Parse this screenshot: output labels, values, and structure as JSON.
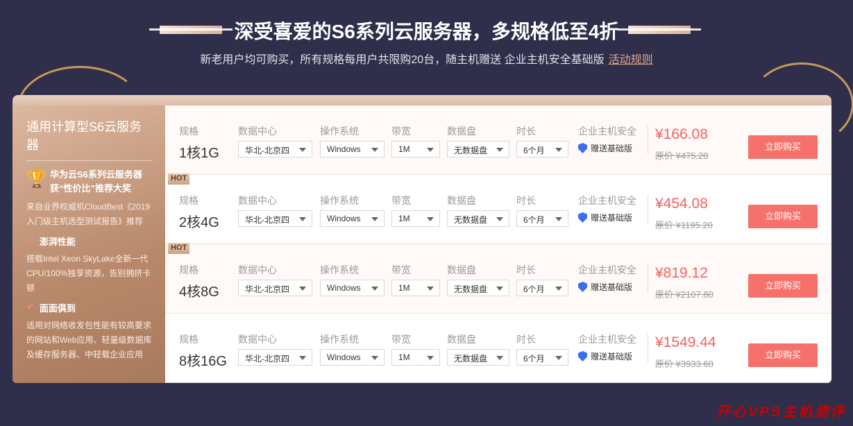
{
  "header": {
    "title": "深受喜爱的S6系列云服务器，多规格低至4折",
    "subtitle": "新老用户均可购买，所有规格每用户共限购20台，随主机赠送 企业主机安全基础版",
    "rules_link": "活动规则"
  },
  "sidebar": {
    "title": "通用计算型S6云服务器",
    "award": "华为云S6系列云服务器获“性价比”推荐大奖",
    "award_source": "来自业界权威机CloudBest《2019入门级主机选型测试报告》推荐",
    "features": [
      {
        "title": "澎湃性能",
        "desc": "搭载Intel Xeon SkyLake全新一代CPU/100%独享资源，告别拥挤卡顿"
      },
      {
        "title": "面面俱到",
        "desc": "适用对网络收发包性能有较高要求的网站和Web应用、轻量级数据库及缓存服务器、中轻载企业应用"
      }
    ]
  },
  "labels": {
    "spec": "规格",
    "region": "数据中心",
    "os": "操作系统",
    "bandwidth": "带宽",
    "disk": "数据盘",
    "duration": "时长",
    "security": "企业主机安全",
    "gift": "赠送基础版",
    "buy": "立即购买",
    "hot": "HOT"
  },
  "rows": [
    {
      "spec": "1核1G",
      "region": "华北-北京四",
      "os": "Windows",
      "bandwidth": "1M",
      "disk": "无数据盘",
      "duration": "6个月",
      "price": "¥166.08",
      "original": "原价 ¥475.20"
    },
    {
      "spec": "2核4G",
      "region": "华北-北京四",
      "os": "Windows",
      "bandwidth": "1M",
      "disk": "无数据盘",
      "duration": "6个月",
      "price": "¥454.08",
      "original": "原价 ¥1195.20"
    },
    {
      "spec": "4核8G",
      "region": "华北-北京四",
      "os": "Windows",
      "bandwidth": "1M",
      "disk": "无数据盘",
      "duration": "6个月",
      "price": "¥819.12",
      "original": "原价 ¥2107.80"
    },
    {
      "spec": "8核16G",
      "region": "华北-北京四",
      "os": "Windows",
      "bandwidth": "1M",
      "disk": "无数据盘",
      "duration": "6个月",
      "price": "¥1549.44",
      "original": "原价 ¥3933.60"
    }
  ],
  "watermark": "开心VPS主机测评"
}
